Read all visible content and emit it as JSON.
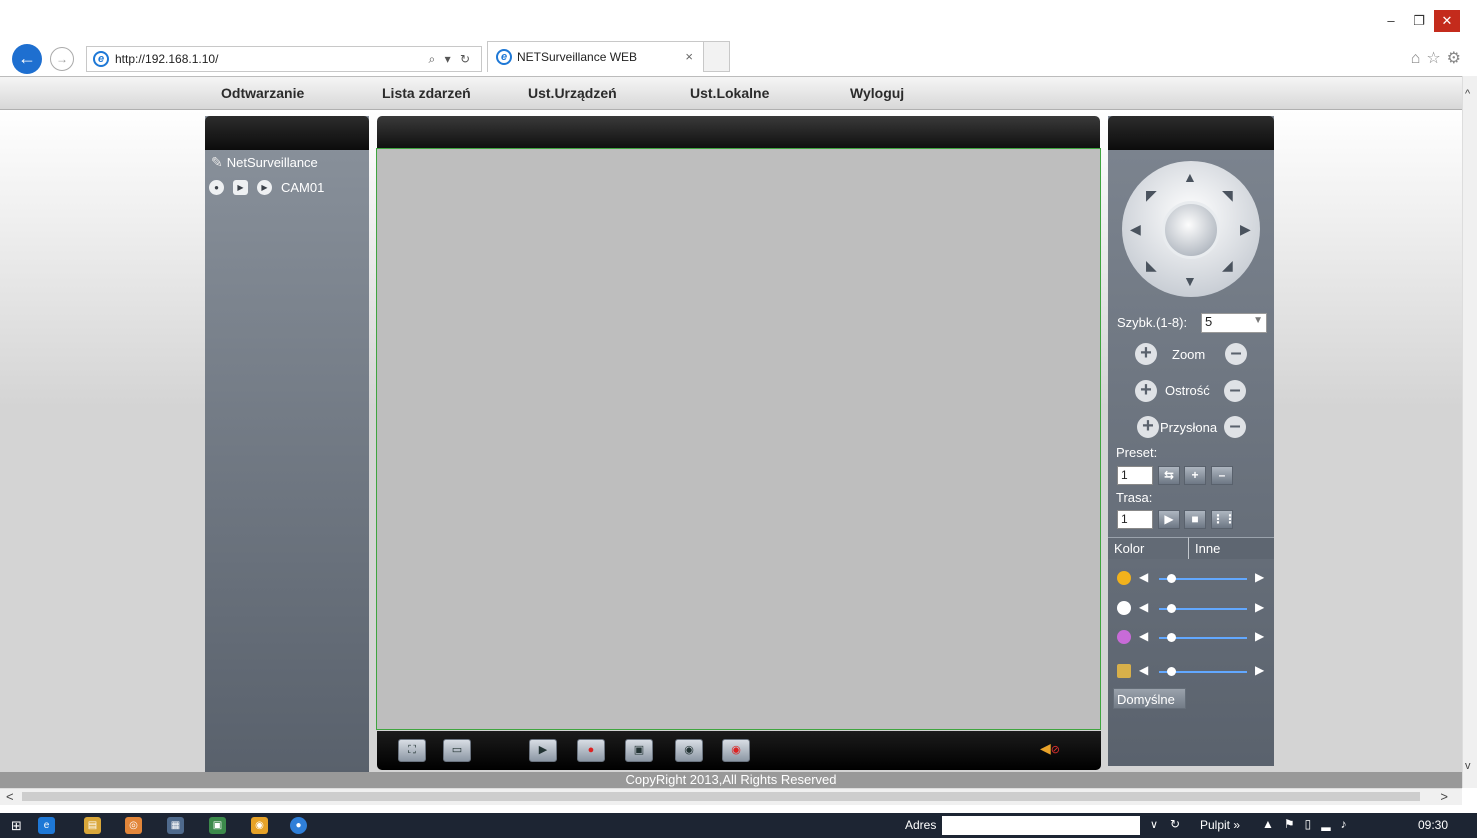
{
  "browser": {
    "url": "http://192.168.1.10/",
    "tab_title": "NETSurveillance WEB",
    "tab_close": "×",
    "address_tools": "⌕ ▾ ↻",
    "toolbar_icons": [
      "home-icon",
      "star-icon",
      "gear-icon"
    ],
    "window_controls": {
      "minimize": "–",
      "restore": "❐",
      "close": "✕"
    }
  },
  "menu": {
    "items": [
      "Odtwarzanie",
      "Lista zdarzeń",
      "Ust.Urządzeń",
      "Ust.Lokalne",
      "Wyloguj"
    ]
  },
  "tree": {
    "root_label": "NetSurveillance",
    "camera_label": "CAM01"
  },
  "video_toolbar": {
    "buttons": [
      "fullscreen-icon",
      "window-icon",
      "record-play-icon",
      "record-stop-icon",
      "snapshot-icon",
      "talk-icon",
      "talk-stop-icon"
    ],
    "audio_icon": "speaker-muted-icon"
  },
  "ptz": {
    "speed_label": "Szybk.(1-8):",
    "speed_value": "5",
    "zoom_label": "Zoom",
    "focus_label": "Ostrość",
    "iris_label": "Przysłona",
    "preset_label": "Preset:",
    "preset_value": "1",
    "cruise_label": "Trasa:",
    "cruise_value": "1"
  },
  "image_tabs": [
    "Kolor",
    "Inne"
  ],
  "image_settings": [
    {
      "icon": "brightness-icon",
      "color": "#f2b21c",
      "level": 0.1
    },
    {
      "icon": "contrast-icon",
      "color": "#ffffff",
      "level": 0.1
    },
    {
      "icon": "saturation-icon",
      "color": "#c86bd8",
      "level": 0.1
    },
    {
      "icon": "hue-icon",
      "color": "#d8b04a",
      "level": 0.1
    }
  ],
  "default_button": "Domyślne",
  "footer": "CopyRight 2013,All Rights Reserved",
  "taskbar": {
    "address_label": "Adres",
    "desktop_label": "Pulpit",
    "time": "09:30"
  },
  "colors": {
    "video_border": "#3fa53f",
    "panel": "#5a626d",
    "slider": "#62a8ff"
  }
}
